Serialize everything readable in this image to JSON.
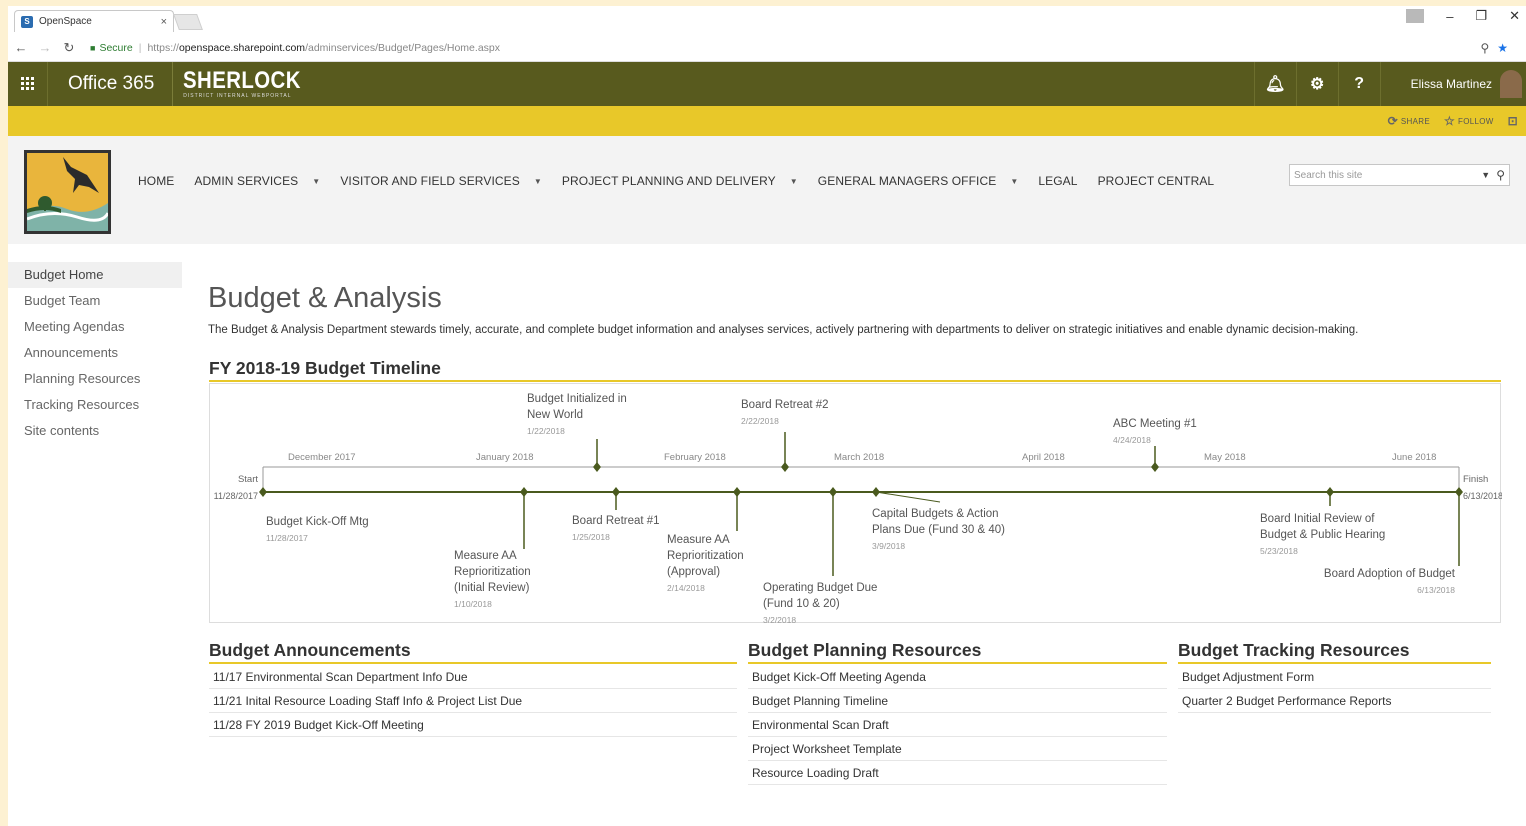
{
  "browser": {
    "tab_title": "OpenSpace",
    "tab_close": "×",
    "secure_label": "Secure",
    "url_scheme": "https://",
    "url_host": "openspace.sharepoint.com",
    "url_path": "/adminservices/Budget/Pages/Home.aspx"
  },
  "suite": {
    "product": "Office 365",
    "site_brand": "SHERLOCK",
    "site_brand_sub": "DISTRICT INTERNAL WEBPORTAL",
    "user_name": "Elissa Martinez"
  },
  "ribbon": {
    "share": "SHARE",
    "follow": "FOLLOW"
  },
  "topnav": [
    {
      "label": "HOME",
      "dropdown": false
    },
    {
      "label": "ADMIN SERVICES",
      "dropdown": true
    },
    {
      "label": "VISITOR AND FIELD SERVICES",
      "dropdown": true
    },
    {
      "label": "PROJECT PLANNING AND DELIVERY",
      "dropdown": true
    },
    {
      "label": "GENERAL MANAGERS OFFICE",
      "dropdown": true
    },
    {
      "label": "LEGAL",
      "dropdown": false
    },
    {
      "label": "PROJECT CENTRAL",
      "dropdown": false
    }
  ],
  "search": {
    "placeholder": "Search this site"
  },
  "leftnav": [
    "Budget Home",
    "Budget Team",
    "Meeting Agendas",
    "Announcements",
    "Planning Resources",
    "Tracking Resources",
    "Site contents"
  ],
  "page": {
    "title": "Budget & Analysis",
    "description": "The Budget & Analysis Department stewards timely, accurate, and complete budget information and analyses services, actively partnering with departments to deliver on strategic initiatives and enable dynamic decision-making.",
    "timeline_heading": "FY 2018-19 Budget Timeline"
  },
  "timeline": {
    "start_label": "Start",
    "start_date": "11/28/2017",
    "finish_label": "Finish",
    "finish_date": "6/13/2018",
    "months": [
      "December 2017",
      "January 2018",
      "February 2018",
      "March 2018",
      "April 2018",
      "May 2018",
      "June 2018"
    ],
    "events": [
      {
        "title": "Budget Kick-Off Mtg",
        "date": "11/28/2017"
      },
      {
        "title": "Measure AA Reprioritization (Initial Review)",
        "date": "1/10/2018"
      },
      {
        "title": "Budget Initialized in New World",
        "date": "1/22/2018"
      },
      {
        "title": "Board Retreat #1",
        "date": "1/25/2018"
      },
      {
        "title": "Measure AA Reprioritization (Approval)",
        "date": "2/14/2018"
      },
      {
        "title": "Board Retreat #2",
        "date": "2/22/2018"
      },
      {
        "title": "Operating Budget Due (Fund 10 & 20)",
        "date": "3/2/2018"
      },
      {
        "title": "Capital Budgets & Action Plans Due (Fund 30 & 40)",
        "date": "3/9/2018"
      },
      {
        "title": "ABC Meeting #1",
        "date": "4/24/2018"
      },
      {
        "title": "Board Initial Review of Budget & Public Hearing",
        "date": "5/23/2018"
      },
      {
        "title": "Board Adoption of Budget",
        "date": "6/13/2018"
      }
    ]
  },
  "announcements": {
    "heading": "Budget Announcements",
    "items": [
      "11/17 Environmental Scan Department Info Due",
      "11/21 Inital Resource Loading Staff Info & Project List Due",
      "11/28 FY 2019 Budget Kick-Off Meeting"
    ]
  },
  "planning": {
    "heading": "Budget Planning Resources",
    "items": [
      "Budget Kick-Off Meeting Agenda",
      "Budget Planning Timeline",
      "Environmental Scan Draft",
      "Project Worksheet Template",
      "Resource Loading Draft"
    ]
  },
  "tracking": {
    "heading": "Budget Tracking Resources",
    "items": [
      "Budget Adjustment Form",
      "Quarter 2 Budget Performance Reports"
    ]
  },
  "colors": {
    "suite_bar": "#585a1e",
    "accent_yellow": "#e8c829",
    "timeline_green": "#4a5a1e"
  }
}
